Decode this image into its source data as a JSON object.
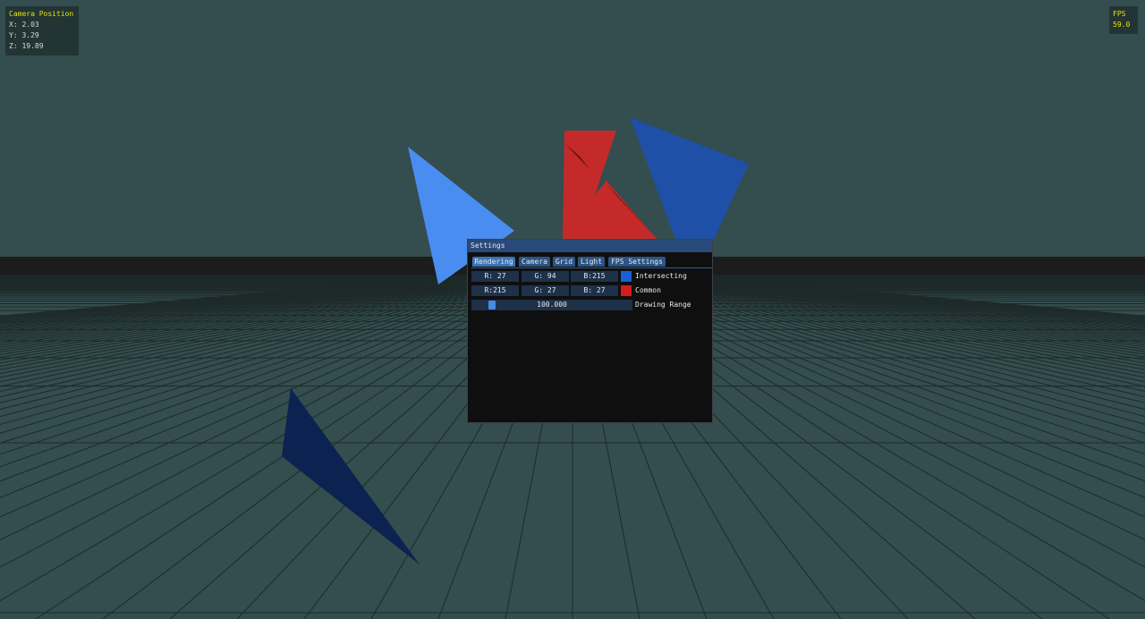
{
  "camera_overlay": {
    "title": "Camera Position",
    "x": "X: 2.03",
    "y": "Y: 3.29",
    "z": "Z: 19.89"
  },
  "fps_overlay": {
    "title": "FPS",
    "value": "59.0"
  },
  "settings": {
    "title": "Settings",
    "tabs": [
      {
        "label": "Rendering",
        "active": true
      },
      {
        "label": "Camera"
      },
      {
        "label": "Grid"
      },
      {
        "label": "Light"
      },
      {
        "label": "FPS Settings"
      }
    ],
    "intersecting": {
      "r": "R: 27",
      "g": "G: 94",
      "b": "B:215",
      "color": "#1b5ed7",
      "label": "Intersecting"
    },
    "common": {
      "r": "R:215",
      "g": "G: 27",
      "b": "B: 27",
      "color": "#d71b1b",
      "label": "Common"
    },
    "drawing_range": {
      "value_text": "100.000",
      "fraction": 0.05,
      "label": "Drawing Range"
    }
  },
  "scene": {
    "background": "#344d4e",
    "horizon_band": "#1c1c1c",
    "grid_line": "#1e2a2a",
    "shape_colors": {
      "light_blue": "#4a8df0",
      "blue": "#1e50a8",
      "red": "#c42a2a",
      "dark_navy": "#0c2250"
    }
  }
}
